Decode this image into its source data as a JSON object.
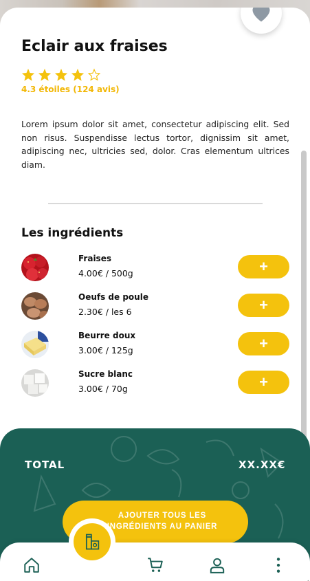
{
  "recipe": {
    "title": "Eclair aux fraises",
    "rating_value": 4,
    "rating_max": 5,
    "rating_text": "4.3 étoiles (124 avis)",
    "description": "Lorem ipsum dolor sit amet, consectetur adipiscing elit. Sed non risus. Suspendisse lectus tortor, dignissim sit amet, adipiscing nec, ultricies sed, dolor. Cras elementum ultrices diam."
  },
  "ingredients": {
    "title": "Les ingrédients",
    "add_label": "+",
    "items": [
      {
        "name": "Fraises",
        "qty": "4.00€ / 500g"
      },
      {
        "name": "Oeufs de poule",
        "qty": "2.30€ / les 6"
      },
      {
        "name": "Beurre doux",
        "qty": "3.00€ / 125g"
      },
      {
        "name": "Sucre blanc",
        "qty": "3.00€ / 70g"
      }
    ]
  },
  "footer": {
    "total_label": "TOTAL",
    "total_value": "XX.XX€",
    "cta_label": "AJOUTER TOUS LES INGRÉDIENTS AU PANIER"
  },
  "icons": {
    "favorite": "heart-icon",
    "home": "home-icon",
    "cart": "cart-icon",
    "profile": "user-icon",
    "menu": "more-vertical-icon",
    "center": "grocery-icon"
  },
  "colors": {
    "accent": "#f4c20d",
    "brand": "#1b6055",
    "star": "#f4c20d"
  }
}
